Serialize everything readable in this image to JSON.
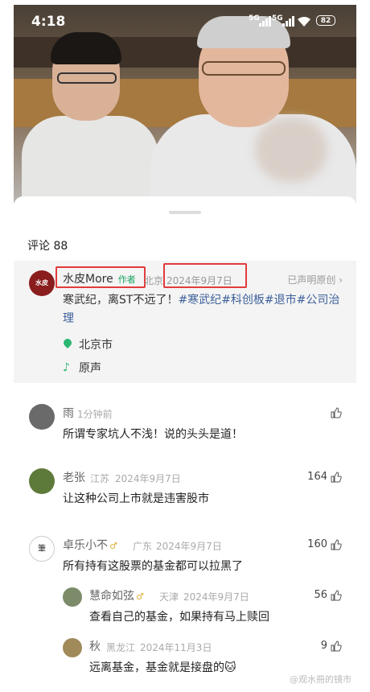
{
  "status_bar": {
    "time": "4:18",
    "sim1": "5G",
    "sim2": "5G",
    "battery": "82"
  },
  "sheet": {
    "comment_title": "评论 88"
  },
  "author_post": {
    "avatar_text": "水皮\nMORE",
    "name": "水皮More",
    "badge": "作者",
    "region": "北京",
    "date": "2024年9月7日",
    "original_label": "已声明原创 ›",
    "text_plain": "寒武纪，离ST不远了！",
    "tags": [
      "#寒武纪",
      "#科创板",
      "#退市",
      "#公司治理"
    ],
    "location": "北京市",
    "sound": "原声"
  },
  "comments": [
    {
      "name": "雨",
      "region": "",
      "time": "1分钟前",
      "text": "所谓专家坑人不浅！说的头头是道！",
      "likes": ""
    },
    {
      "name": "老张",
      "region": "江苏",
      "time": "2024年9月7日",
      "text": "让这种公司上市就是违害股市",
      "likes": "164"
    },
    {
      "name": "卓乐小不",
      "gender": "♂",
      "region": "广东",
      "time": "2024年9月7日",
      "text": "所有持有这股票的基金都可以拉黑了",
      "likes": "160"
    },
    {
      "name": "慧命如弦",
      "gender": "♂",
      "region": "天津",
      "time": "2024年9月7日",
      "text": "查看自己的基金，如果持有马上赎回",
      "likes": "56"
    },
    {
      "name": "秋",
      "region": "黑龙江",
      "time": "2024年11月3日",
      "text": "远离基金，基金就是接盘的🐱",
      "likes": "9"
    }
  ],
  "watermark": "@观水冊的镜市",
  "colors": {
    "accent_green": "#2bb673",
    "tag_blue": "#3b5f9a",
    "highlight_red": "#e23b3b"
  }
}
